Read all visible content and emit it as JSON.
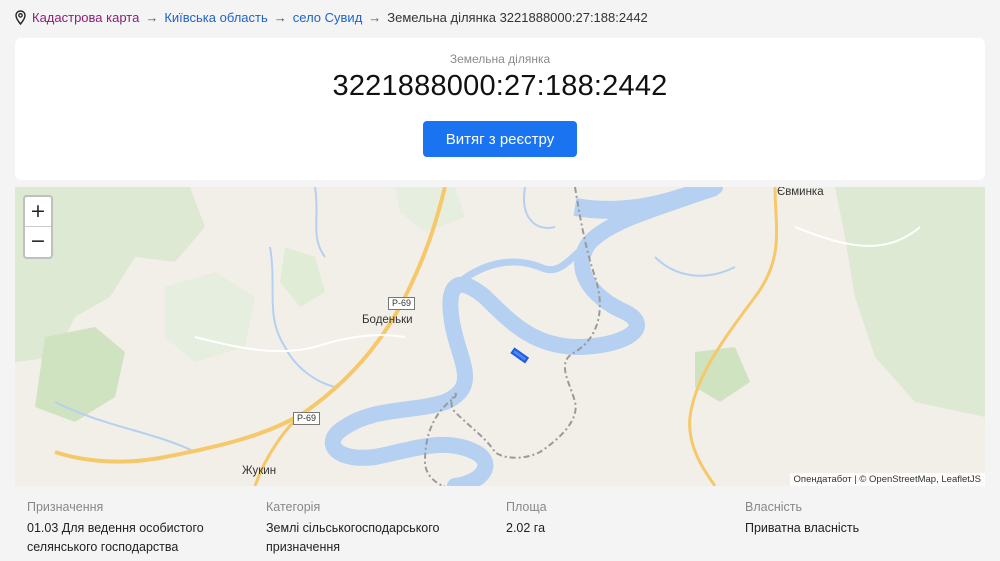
{
  "breadcrumb": {
    "root": "Кадастрова карта",
    "region": "Київська область",
    "village": "село Сувид",
    "current": "Земельна ділянка 3221888000:27:188:2442",
    "separator": "→"
  },
  "card": {
    "subtitle": "Земельна ділянка",
    "cadastral_number": "3221888000:27:188:2442",
    "extract_button": "Витяг з реєстру"
  },
  "map": {
    "zoom_in": "+",
    "zoom_out": "−",
    "places": {
      "bodenky": "Боденьки",
      "zhukyn": "Жукин",
      "yevmynka": "Євминка"
    },
    "road_shields": {
      "top": "Р-69",
      "bottom": "Р-69"
    },
    "attribution": {
      "provider": "Опендатабот",
      "sep": " | © ",
      "osm": "OpenStreetMap",
      "comma": ", ",
      "leaflet": "LeafletJS"
    },
    "colors": {
      "water": "#b5d0f0",
      "forest": "#d9e8cd",
      "land": "#f2efe9",
      "road": "#f6c86a",
      "parcel": "#1e5fe0"
    }
  },
  "details": {
    "purpose": {
      "label": "Призначення",
      "value": "01.03 Для ведення особистого селянського господарства"
    },
    "category": {
      "label": "Категорія",
      "value": "Землі сільськогосподарського призначення"
    },
    "area": {
      "label": "Площа",
      "value": "2.02 га"
    },
    "ownership": {
      "label": "Власність",
      "value": "Приватна власність"
    }
  }
}
